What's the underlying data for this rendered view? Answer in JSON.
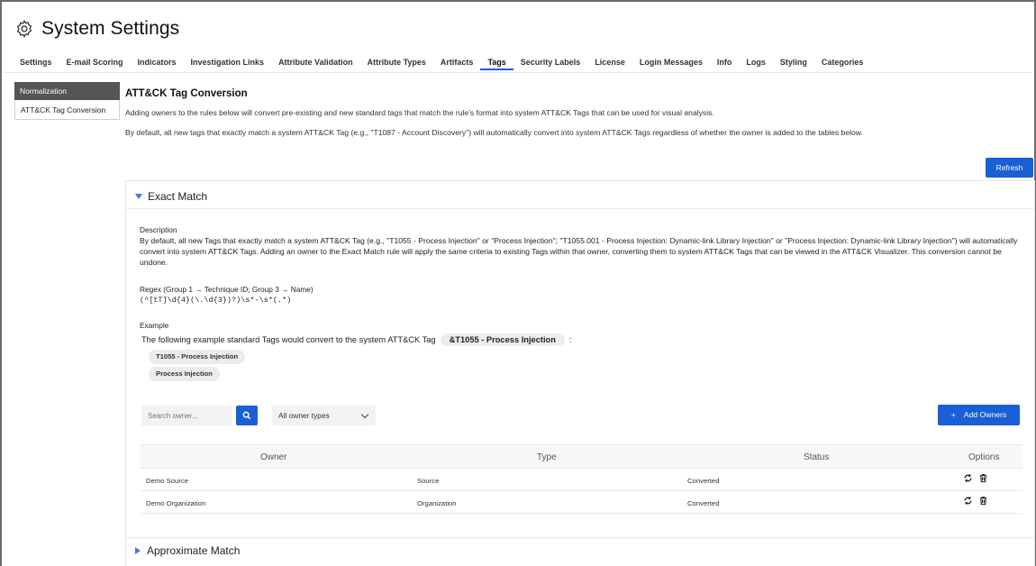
{
  "header": {
    "title": "System Settings",
    "icon": "gear-icon"
  },
  "tabs": [
    {
      "label": "Settings"
    },
    {
      "label": "E-mail Scoring"
    },
    {
      "label": "Indicators"
    },
    {
      "label": "Investigation Links"
    },
    {
      "label": "Attribute Validation"
    },
    {
      "label": "Attribute Types"
    },
    {
      "label": "Artifacts"
    },
    {
      "label": "Tags",
      "active": true
    },
    {
      "label": "Security Labels"
    },
    {
      "label": "License"
    },
    {
      "label": "Login Messages"
    },
    {
      "label": "Info"
    },
    {
      "label": "Logs"
    },
    {
      "label": "Styling"
    },
    {
      "label": "Categories"
    }
  ],
  "sidebar": {
    "heading": "Normalization",
    "items": [
      {
        "label": "ATT&CK Tag Conversion"
      }
    ]
  },
  "main": {
    "title": "ATT&CK Tag Conversion",
    "intro": "Adding owners to the rules below will convert pre-existing and new standard tags that match the rule's format into system ATT&CK Tags that can be used for visual analysis.",
    "note": "By default, all new tags that exactly match a system ATT&CK Tag (e.g., \"T1087 - Account Discovery\") will automatically convert into system ATT&CK Tags regardless of whether the owner is added to the tables below.",
    "refresh_label": "Refresh"
  },
  "exact_match": {
    "title": "Exact Match",
    "expanded": true,
    "description_label": "Description",
    "description": "By default, all new Tags that exactly match a system ATT&CK Tag (e.g., \"T1055 - Process Injection\" or \"Process Injection\"; \"T1055.001 - Process Injection: Dynamic-link Library Injection\" or \"Process Injection: Dynamic-link Library Injection\") will automatically convert into system ATT&CK Tags. Adding an owner to the Exact Match rule will apply the same criteria to existing Tags within that owner, converting them to system ATT&CK Tags that can be viewed in the ATT&CK Visualizer. This conversion cannot be undone.",
    "regex_label": "Regex (Group 1 → Technique ID; Group 3 → Name)",
    "regex": "(^[tT]\\d{4}(\\.\\d{3})?)\\s*-\\s*(.*)",
    "example_label": "Example",
    "example_text": "The following example standard Tags would convert to the system ATT&CK Tag",
    "example_target": "&T1055 - Process Injection",
    "example_colon": ":",
    "example_tags": [
      "T1055 - Process Injection",
      "Process Injection"
    ],
    "search_placeholder": "Search owner...",
    "owner_type_selected": "All owner types",
    "add_owners_label": "Add Owners",
    "add_owners_plus": "+",
    "columns": [
      "Owner",
      "Type",
      "Status",
      "Options"
    ],
    "rows": [
      {
        "owner": "Demo Source",
        "type": "Source",
        "status": "Converted"
      },
      {
        "owner": "Demo Organization",
        "type": "Organization",
        "status": "Converted"
      }
    ]
  },
  "approximate_match": {
    "title": "Approximate Match",
    "expanded": false
  },
  "colors": {
    "accent": "#1a5fd6",
    "sidebar_head": "#555555"
  }
}
